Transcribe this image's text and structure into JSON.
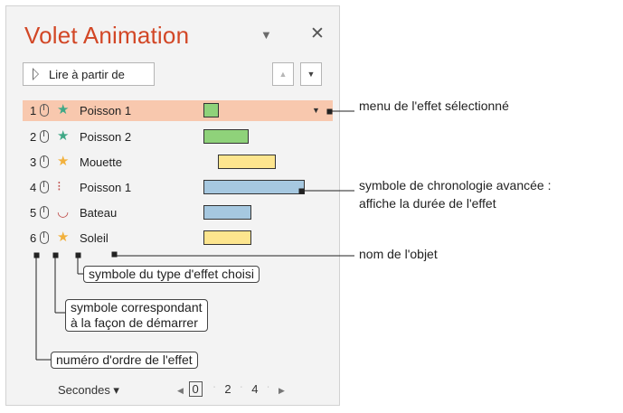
{
  "panel": {
    "title": "Volet Animation",
    "play_label": "Lire à partir de",
    "rows": [
      {
        "num": "1",
        "icon": "★",
        "icon_color": "#3fa886",
        "name": "Poisson 1",
        "bar_color": "#8fd27a",
        "selected": true
      },
      {
        "num": "2",
        "icon": "★",
        "icon_color": "#3fa886",
        "name": "Poisson 2",
        "bar_color": "#8fd27a",
        "selected": false
      },
      {
        "num": "3",
        "icon": "★",
        "icon_color": "#f2b13c",
        "name": "Mouette",
        "bar_color": "#fde58e",
        "selected": false
      },
      {
        "num": "4",
        "icon": "⁝",
        "icon_color": "#c0504d",
        "name": "Poisson 1",
        "bar_color": "#a6c8e0",
        "selected": false
      },
      {
        "num": "5",
        "icon": "◡",
        "icon_color": "#c0504d",
        "name": "Bateau",
        "bar_color": "#a6c8e0",
        "selected": false
      },
      {
        "num": "6",
        "icon": "★",
        "icon_color": "#f2b13c",
        "name": "Soleil",
        "bar_color": "#fde58e",
        "selected": false
      }
    ],
    "footer_label": "Secondes ▾",
    "zoom": {
      "start": "0",
      "mid": "2",
      "end": "4"
    }
  },
  "annotations": {
    "menu_effect": "menu de l'effet sélectionné",
    "timeline_line1": "symbole de chronologie avancée :",
    "timeline_line2": "affiche la durée de l'effet",
    "object_name": "nom de l'objet",
    "effect_type": "symbole du type d'effet choisi",
    "start_line1": "symbole correspondant",
    "start_line2": "à la façon de démarrer",
    "order_number": "numéro d'ordre de l'effet"
  }
}
